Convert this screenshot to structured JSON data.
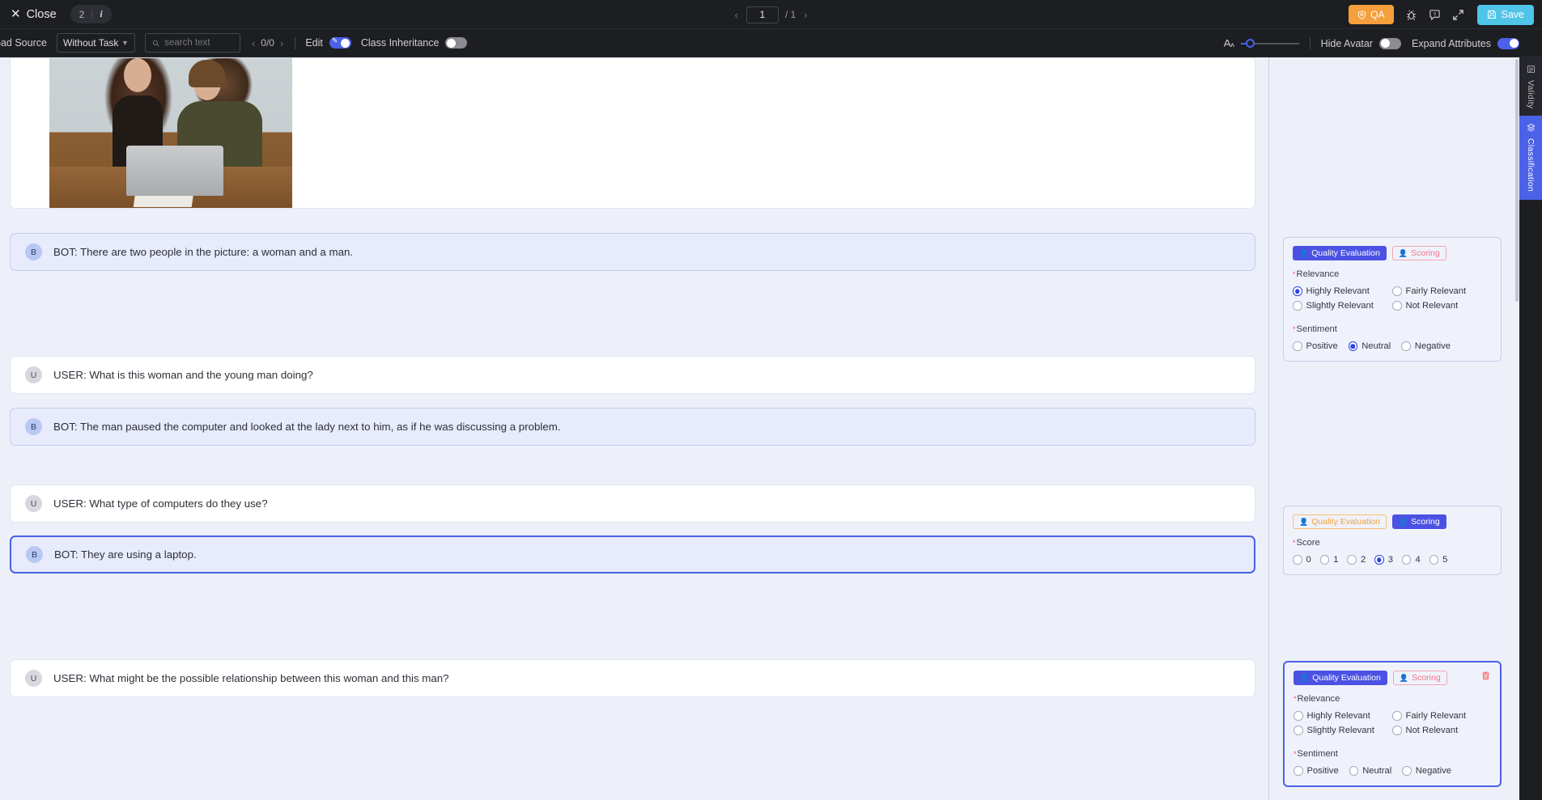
{
  "topbar": {
    "close_label": "Close",
    "close_icon": "close-x-icon",
    "badge_count": "2",
    "badge_info": "i",
    "pager": {
      "prev": "‹",
      "current": "1",
      "separator": "/ 1",
      "next": "›"
    },
    "qa_label": "QA",
    "qa_icon": "shield-check-icon",
    "bug_icon": "bug-icon",
    "help_icon": "help-circle-icon",
    "fullscreen_icon": "expand-icon",
    "save_label": "Save",
    "save_icon": "floppy-disk-icon",
    "qa_color": "#f5a03c",
    "save_color": "#4fc3e8"
  },
  "toolbar": {
    "source_label": "oad Source",
    "task_select_value": "Without Task",
    "search_placeholder": "search text",
    "search_value": "",
    "search_icon": "search-icon",
    "hit_prev": "‹",
    "hit_count": "0/0",
    "hit_next": "›",
    "edit_label": "Edit",
    "edit_on": true,
    "class_inheritance_label": "Class Inheritance",
    "class_inheritance_on": false,
    "font_size_icon": "font-size-icon",
    "hide_avatar_label": "Hide Avatar",
    "hide_avatar_on": false,
    "expand_attributes_label": "Expand Attributes",
    "expand_attributes_on": true
  },
  "media": {
    "alt": "woman and man working at a laptop in an office"
  },
  "messages": [
    {
      "role": "bot",
      "avatar": "B",
      "text": "BOT: There are two people in the picture: a woman and a man.",
      "selected": false
    },
    {
      "role": "user",
      "avatar": "U",
      "text": "USER: What is this woman and the young man doing?",
      "selected": false
    },
    {
      "role": "bot",
      "avatar": "B",
      "text": "BOT: The man paused the computer and looked at the lady next to him, as if he was discussing a problem.",
      "selected": false
    },
    {
      "role": "user",
      "avatar": "U",
      "text": "USER: What type of computers do they use?",
      "selected": false
    },
    {
      "role": "bot",
      "avatar": "B",
      "text": "BOT: They are using a laptop.",
      "selected": true
    },
    {
      "role": "user",
      "avatar": "U",
      "text": "USER: What might be the possible relationship between this woman and this man?",
      "selected": false
    }
  ],
  "panels": [
    {
      "selected": false,
      "show_delete": false,
      "chips": [
        {
          "label": "Quality Evaluation",
          "style": "blue-solid",
          "icon": "user-tag-icon"
        },
        {
          "label": "Scoring",
          "style": "red-out",
          "icon": "user-tag-icon"
        }
      ],
      "fields": [
        {
          "label": "Relevance",
          "required": true,
          "layout": "cols2",
          "options": [
            {
              "label": "Highly Relevant",
              "selected": true
            },
            {
              "label": "Fairly Relevant",
              "selected": false
            },
            {
              "label": "Slightly Relevant",
              "selected": false
            },
            {
              "label": "Not Relevant",
              "selected": false
            }
          ]
        },
        {
          "label": "Sentiment",
          "required": true,
          "layout": "inline",
          "options": [
            {
              "label": "Positive",
              "selected": false
            },
            {
              "label": "Neutral",
              "selected": true
            },
            {
              "label": "Negative",
              "selected": false
            }
          ]
        }
      ]
    },
    {
      "selected": false,
      "show_delete": false,
      "chips": [
        {
          "label": "Quality Evaluation",
          "style": "orange-out",
          "icon": "user-tag-icon"
        },
        {
          "label": "Scoring",
          "style": "blue-solid",
          "icon": "user-tag-icon"
        }
      ],
      "fields": [
        {
          "label": "Score",
          "required": true,
          "layout": "score",
          "options": [
            {
              "label": "0",
              "selected": false
            },
            {
              "label": "1",
              "selected": false
            },
            {
              "label": "2",
              "selected": false
            },
            {
              "label": "3",
              "selected": true
            },
            {
              "label": "4",
              "selected": false
            },
            {
              "label": "5",
              "selected": false
            }
          ]
        }
      ]
    },
    {
      "selected": true,
      "show_delete": true,
      "delete_icon": "trash-icon",
      "chips": [
        {
          "label": "Quality Evaluation",
          "style": "blue-solid",
          "icon": "user-tag-icon"
        },
        {
          "label": "Scoring",
          "style": "red-out",
          "icon": "user-tag-icon"
        }
      ],
      "fields": [
        {
          "label": "Relevance",
          "required": true,
          "layout": "cols2",
          "options": [
            {
              "label": "Highly Relevant",
              "selected": false
            },
            {
              "label": "Fairly Relevant",
              "selected": false
            },
            {
              "label": "Slightly Relevant",
              "selected": false
            },
            {
              "label": "Not Relevant",
              "selected": false
            }
          ]
        },
        {
          "label": "Sentiment",
          "required": true,
          "layout": "inline",
          "options": [
            {
              "label": "Positive",
              "selected": false
            },
            {
              "label": "Neutral",
              "selected": false
            },
            {
              "label": "Negative",
              "selected": false
            }
          ]
        }
      ]
    }
  ],
  "rail": {
    "tabs": [
      {
        "label": "Validity",
        "icon": "list-check-icon",
        "active": false
      },
      {
        "label": "Classification",
        "icon": "layers-icon",
        "active": true
      }
    ]
  }
}
